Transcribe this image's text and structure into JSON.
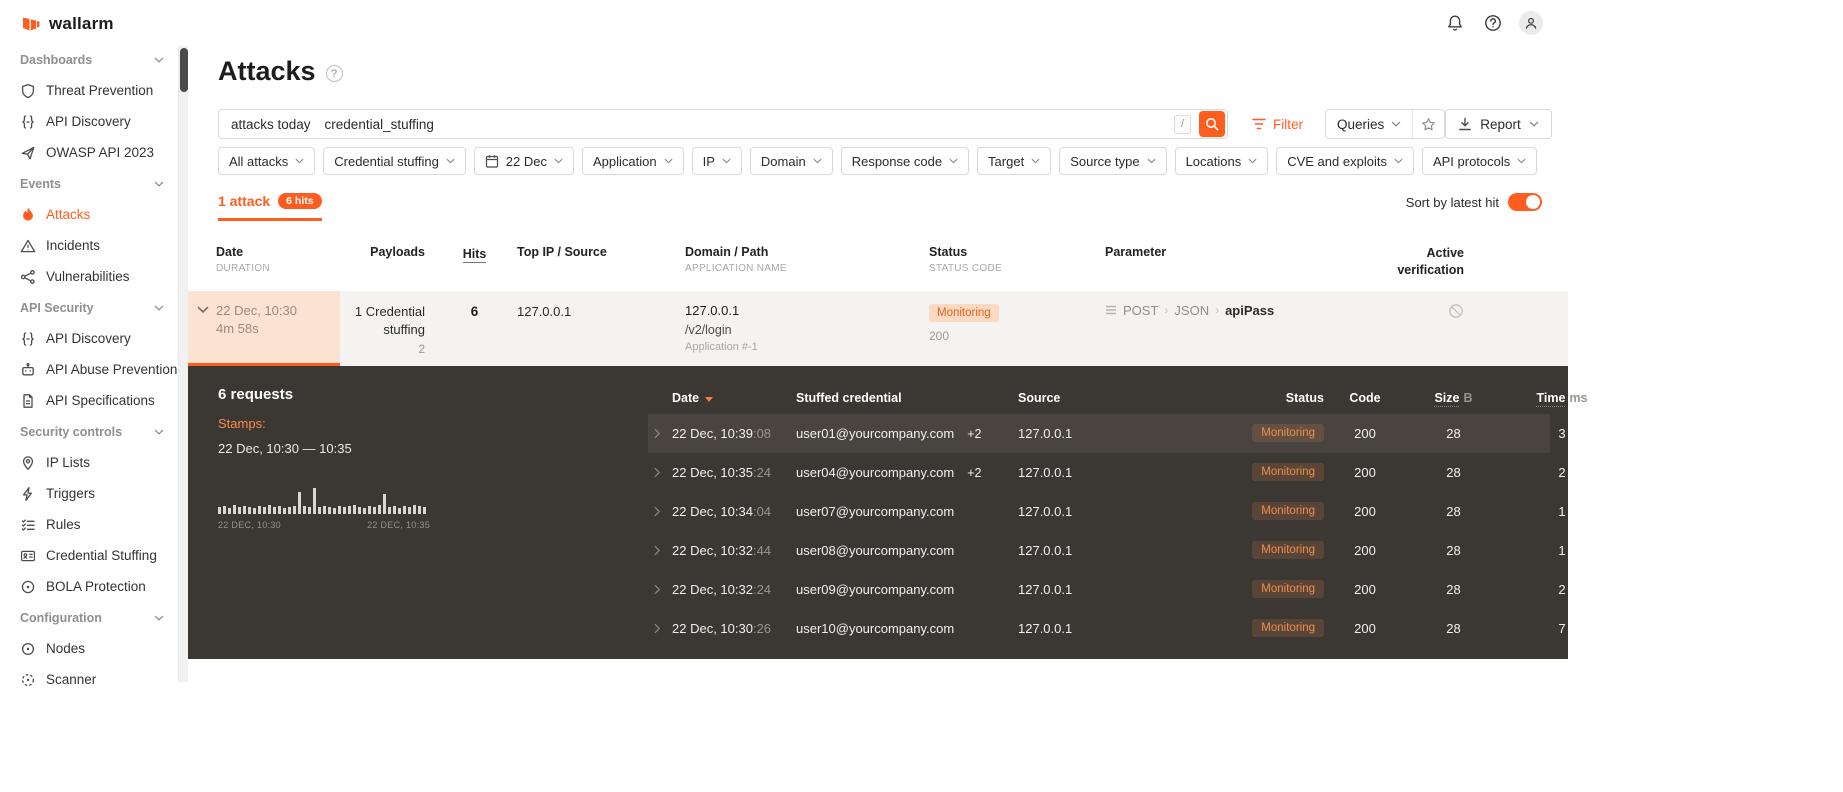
{
  "colors": {
    "accent": "#ff5c20",
    "panel_bg": "#3b3733",
    "row_peach": "#fbe2d1",
    "row_gray": "#f4f3f1",
    "badge_light_bg": "#fcd9c2",
    "badge_light_text": "#e0661a",
    "badge_dark_text": "#ef8e4e"
  },
  "brand": {
    "logo_text": "wallarm",
    "logo_icon": "wallarm-mark"
  },
  "topbar": {
    "icons": [
      "bell-icon",
      "help-icon",
      "user-icon"
    ]
  },
  "sidebar": {
    "sections": [
      {
        "header": "Dashboards",
        "items": [
          {
            "label": "Threat Prevention",
            "icon": "shield-icon"
          },
          {
            "label": "API Discovery",
            "icon": "braces-icon"
          },
          {
            "label": "OWASP API 2023",
            "icon": "paper-plane-icon"
          }
        ]
      },
      {
        "header": "Events",
        "items": [
          {
            "label": "Attacks",
            "icon": "flame-icon",
            "active": true
          },
          {
            "label": "Incidents",
            "icon": "warning-icon"
          },
          {
            "label": "Vulnerabilities",
            "icon": "network-icon"
          }
        ]
      },
      {
        "header": "API Security",
        "items": [
          {
            "label": "API Discovery",
            "icon": "braces-icon"
          },
          {
            "label": "API Abuse Prevention",
            "icon": "robot-icon"
          },
          {
            "label": "API Specifications",
            "icon": "document-icon"
          }
        ]
      },
      {
        "header": "Security controls",
        "items": [
          {
            "label": "IP Lists",
            "icon": "pin-icon"
          },
          {
            "label": "Triggers",
            "icon": "bolt-icon"
          },
          {
            "label": "Rules",
            "icon": "checklist-icon"
          },
          {
            "label": "Credential Stuffing",
            "icon": "id-card-icon"
          },
          {
            "label": "BOLA Protection",
            "icon": "target-icon"
          }
        ]
      },
      {
        "header": "Configuration",
        "items": [
          {
            "label": "Nodes",
            "icon": "node-icon"
          },
          {
            "label": "Scanner",
            "icon": "scanner-icon"
          }
        ]
      }
    ]
  },
  "page": {
    "title": "Attacks",
    "search": {
      "tokens": [
        "attacks today",
        "credential_stuffing"
      ],
      "shortcut_hint": "/"
    },
    "toolbar": {
      "filter": "Filter",
      "queries": "Queries",
      "report": "Report"
    },
    "filter_chips": [
      {
        "label": "All attacks"
      },
      {
        "label": "Credential stuffing"
      },
      {
        "label": "22 Dec",
        "icon": "calendar-icon"
      },
      {
        "label": "Application"
      },
      {
        "label": "IP"
      },
      {
        "label": "Domain"
      },
      {
        "label": "Response code"
      },
      {
        "label": "Target"
      },
      {
        "label": "Source type"
      },
      {
        "label": "Locations"
      },
      {
        "label": "CVE and exploits"
      },
      {
        "label": "API protocols"
      }
    ],
    "results_tab": {
      "label": "1 attack",
      "badge": "6 hits"
    },
    "sort_toggle": {
      "label": "Sort by latest hit",
      "state": "on"
    }
  },
  "attack_table": {
    "headers": {
      "date": "Date",
      "date_sub": "DURATION",
      "payloads": "Payloads",
      "hits": "Hits",
      "source": "Top IP / Source",
      "domain": "Domain / Path",
      "domain_sub": "APPLICATION NAME",
      "status": "Status",
      "status_sub": "STATUS CODE",
      "parameter": "Parameter",
      "verification_line1": "Active",
      "verification_line2": "verification"
    },
    "row": {
      "date": "22 Dec, 10:30",
      "duration": "4m 58s",
      "payload": "1 Credential stuffing",
      "payload_count": "2",
      "hits": "6",
      "top_ip": "127.0.0.1",
      "domain": "127.0.0.1",
      "path": "/v2/login",
      "application": "Application #-1",
      "status": "Monitoring",
      "status_code": "200",
      "parameter_crumbs": [
        "POST",
        "JSON",
        "apiPass"
      ]
    }
  },
  "details": {
    "title": "6 requests",
    "stamps_label": "Stamps:",
    "stamps_range": "22 Dec, 10:30 — 10:35",
    "histogram": {
      "start_label": "22 DEC, 10:30",
      "end_label": "22 DEC, 10:35",
      "bars": [
        7,
        8,
        6,
        9,
        7,
        8,
        7,
        6,
        8,
        7,
        9,
        7,
        8,
        6,
        7,
        8,
        22,
        8,
        7,
        26,
        7,
        8,
        7,
        6,
        8,
        7,
        8,
        9,
        7,
        6,
        8,
        7,
        9,
        20,
        7,
        8,
        6,
        8,
        7,
        9,
        8,
        7
      ]
    },
    "table": {
      "headers": {
        "date": "Date",
        "credential": "Stuffed credential",
        "source": "Source",
        "status": "Status",
        "code": "Code",
        "size": "Size",
        "size_unit": "B",
        "time": "Time",
        "time_unit": "ms"
      },
      "rows": [
        {
          "date": "22 Dec, 10:39",
          "seconds": ":08",
          "credential": "user01@yourcompany.com",
          "extra": "+2",
          "source": "127.0.0.1",
          "status": "Monitoring",
          "code": "200",
          "size": "28",
          "time": "3"
        },
        {
          "date": "22 Dec, 10:35",
          "seconds": ":24",
          "credential": "user04@yourcompany.com",
          "extra": "+2",
          "source": "127.0.0.1",
          "status": "Monitoring",
          "code": "200",
          "size": "28",
          "time": "2"
        },
        {
          "date": "22 Dec, 10:34",
          "seconds": ":04",
          "credential": "user07@yourcompany.com",
          "extra": "",
          "source": "127.0.0.1",
          "status": "Monitoring",
          "code": "200",
          "size": "28",
          "time": "1"
        },
        {
          "date": "22 Dec, 10:32",
          "seconds": ":44",
          "credential": "user08@yourcompany.com",
          "extra": "",
          "source": "127.0.0.1",
          "status": "Monitoring",
          "code": "200",
          "size": "28",
          "time": "1"
        },
        {
          "date": "22 Dec, 10:32",
          "seconds": ":24",
          "credential": "user09@yourcompany.com",
          "extra": "",
          "source": "127.0.0.1",
          "status": "Monitoring",
          "code": "200",
          "size": "28",
          "time": "2"
        },
        {
          "date": "22 Dec, 10:30",
          "seconds": ":26",
          "credential": "user10@yourcompany.com",
          "extra": "",
          "source": "127.0.0.1",
          "status": "Monitoring",
          "code": "200",
          "size": "28",
          "time": "7"
        }
      ]
    }
  }
}
